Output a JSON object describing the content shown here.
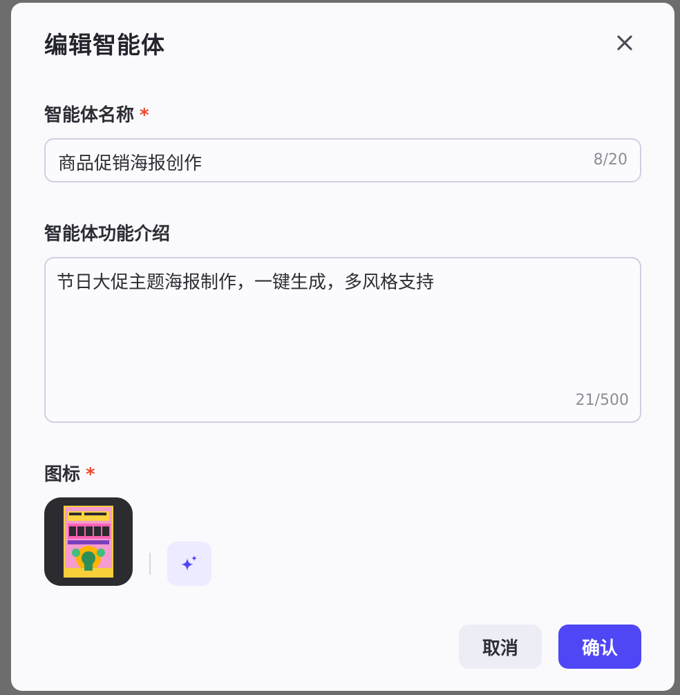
{
  "dialog": {
    "title": "编辑智能体"
  },
  "name_field": {
    "label": "智能体名称",
    "required_mark": "*",
    "value": "商品促销海报创作",
    "counter": "8/20"
  },
  "description_field": {
    "label": "智能体功能介绍",
    "value": "节日大促主题海报制作，一键生成，多风格支持",
    "counter": "21/500"
  },
  "icon_field": {
    "label": "图标",
    "required_mark": "*",
    "ai_generate_icon": "sparkle-icon"
  },
  "footer": {
    "cancel_label": "取消",
    "confirm_label": "确认"
  },
  "colors": {
    "primary": "#4f46f6",
    "required": "#f0452a",
    "ai_button_bg": "#ecebff"
  }
}
